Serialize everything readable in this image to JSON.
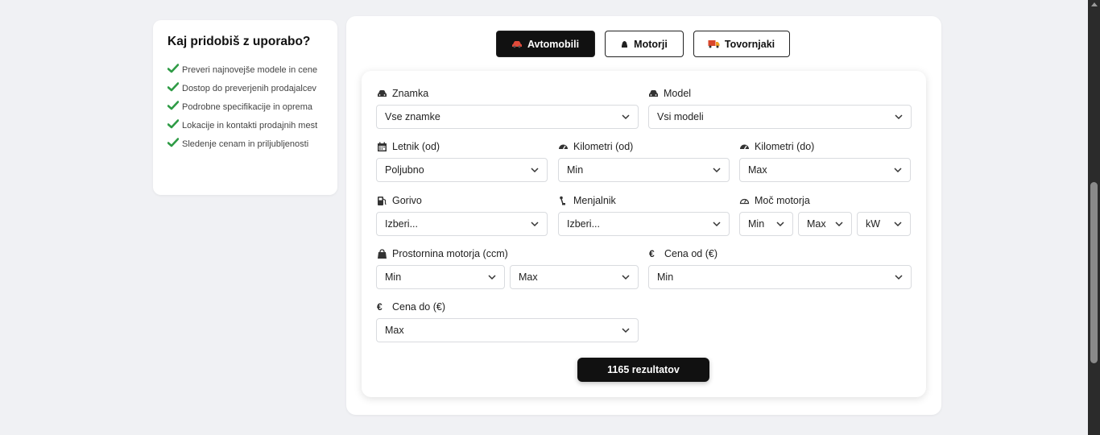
{
  "info": {
    "title": "Kaj pridobiš z uporabo?",
    "benefits": [
      "Preveri najnovejše modele in cene",
      "Dostop do preverjenih prodajalcev",
      "Podrobne specifikacije in oprema",
      "Lokacije in kontakti prodajnih mest",
      "Sledenje cenam in priljubljenosti"
    ],
    "check_color": "#2e9b45"
  },
  "tabs": [
    {
      "label": "Avtomobili",
      "icon": "car-icon",
      "active": true
    },
    {
      "label": "Motorji",
      "icon": "motorcycle-icon",
      "active": false
    },
    {
      "label": "Tovornjaki",
      "icon": "truck-icon",
      "active": false
    }
  ],
  "filters": {
    "brand": {
      "label": "Znamka",
      "value": "Vse znamke",
      "icon": "car-icon"
    },
    "model": {
      "label": "Model",
      "value": "Vsi modeli",
      "icon": "car-icon"
    },
    "year_from": {
      "label": "Letnik (od)",
      "value": "Poljubno",
      "icon": "calendar-icon"
    },
    "km_from": {
      "label": "Kilometri (od)",
      "value": "Min",
      "icon": "speedometer-icon"
    },
    "km_to": {
      "label": "Kilometri (do)",
      "value": "Max",
      "icon": "speedometer-icon"
    },
    "fuel": {
      "label": "Gorivo",
      "value": "Izberi...",
      "icon": "fuel-pump-icon"
    },
    "transmission": {
      "label": "Menjalnik",
      "value": "Izberi...",
      "icon": "gear-shift-icon"
    },
    "power": {
      "label": "Moč motorja",
      "min": "Min",
      "max": "Max",
      "unit": "kW",
      "icon": "gauge-icon"
    },
    "displacement": {
      "label": "Prostornina motorja (ccm)",
      "min": "Min",
      "max": "Max",
      "icon": "weight-icon"
    },
    "price_from": {
      "label": "Cena od (€)",
      "value": "Min",
      "icon": "euro-icon"
    },
    "price_to": {
      "label": "Cena do (€)",
      "value": "Max",
      "icon": "euro-icon"
    }
  },
  "results_button": "1165 rezultatov"
}
